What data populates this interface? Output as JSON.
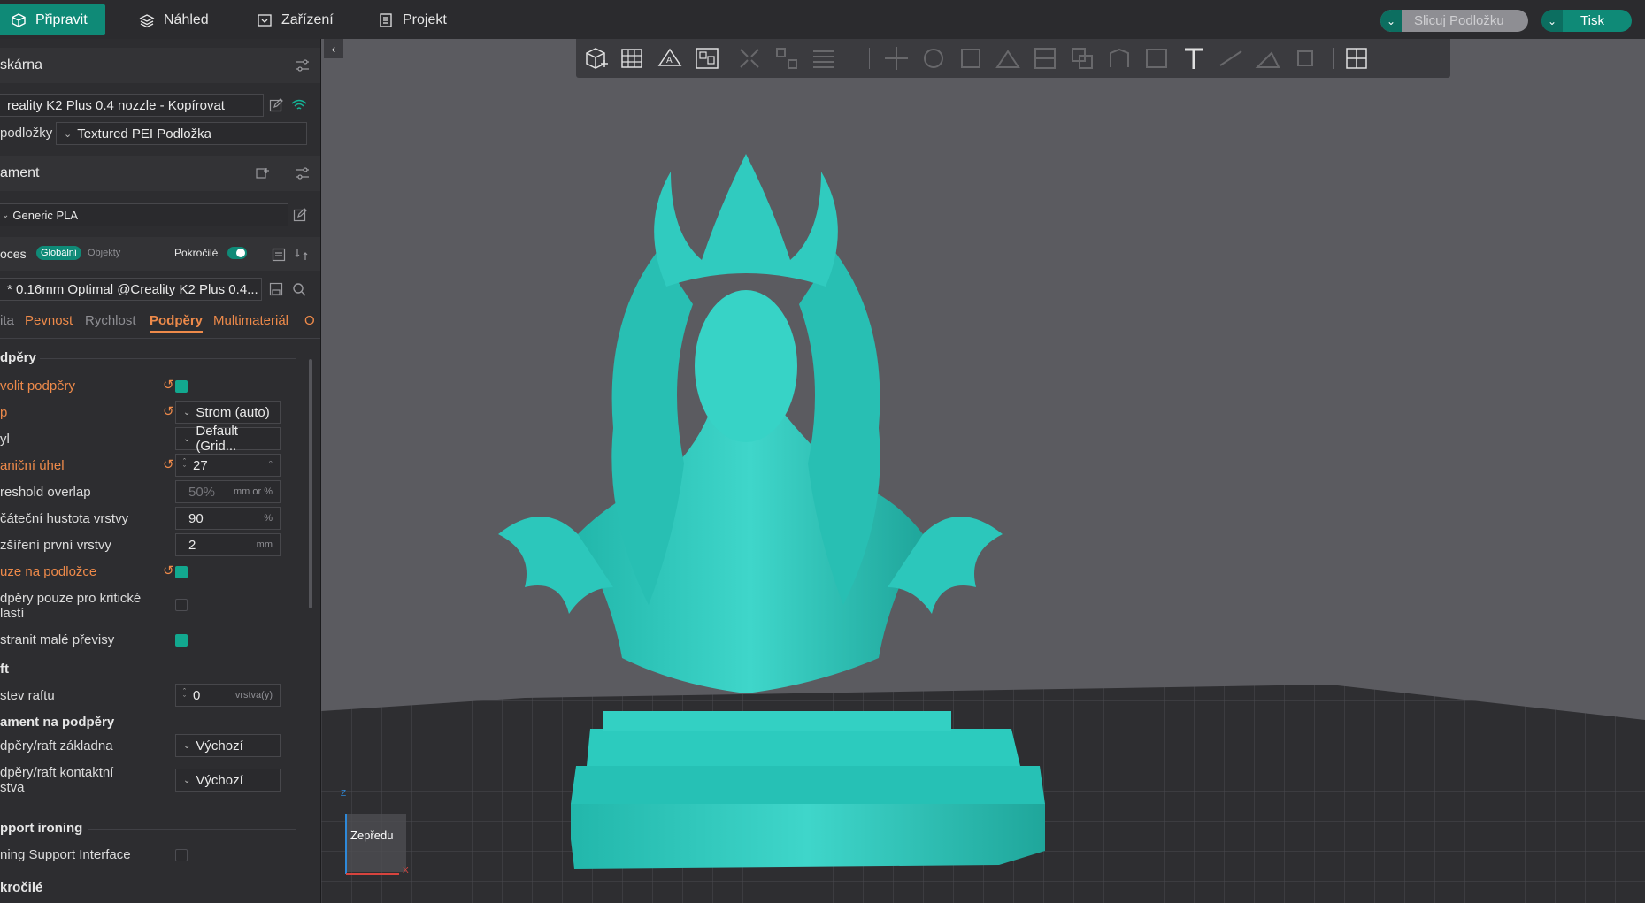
{
  "top_tabs": [
    {
      "label": "Připravit",
      "active": true
    },
    {
      "label": "Náhled"
    },
    {
      "label": "Zařízení"
    },
    {
      "label": "Projekt"
    }
  ],
  "top_actions": {
    "slice_label": "Slicuj Podložku",
    "print_label": "Tisk"
  },
  "printer": {
    "section_title": "skárna",
    "printer_name": "reality K2 Plus 0.4 nozzle - Kopírovat",
    "bed_label": "podložky",
    "bed_value": "Textured PEI Podložka"
  },
  "filament": {
    "section_title": "ament",
    "value": "Generic PLA"
  },
  "process": {
    "section_title": "oces",
    "toggle_global": "Globální",
    "toggle_objects": "Objekty",
    "advanced_label": "Pokročilé",
    "profile": "* 0.16mm Optimal @Creality K2 Plus 0.4..."
  },
  "category_tabs": [
    "ita",
    "Pevnost",
    "Rychlost",
    "Podpěry",
    "Multimateriál",
    "O"
  ],
  "groups": {
    "supports": "dpěry",
    "raft": "ft",
    "filament_supports": "ament na podpěry",
    "support_ironing": "pport ironing",
    "advanced": "kročilé"
  },
  "settings": {
    "enable_supports": "volit podpěry",
    "type_label": "p",
    "type_value": "Strom (auto)",
    "style_label": "yl",
    "style_value": "Default (Grid...",
    "angle_label": "aniční úhel",
    "angle_value": "27",
    "threshold_label": "reshold overlap",
    "threshold_value": "50%",
    "threshold_unit": "mm or %",
    "initial_density_label": "čáteční hustota vrstvy",
    "initial_density_value": "90",
    "initial_density_unit": "%",
    "first_layer_exp_label": "zšíření první vrstvy",
    "first_layer_exp_value": "2",
    "first_layer_exp_unit": "mm",
    "on_bed_only_label": "uze na podložce",
    "critical_only_label_1": "dpěry pouze pro kritické",
    "critical_only_label_2": "lastí",
    "remove_small_label": "stranit malé převisy",
    "raft_layers_label": "stev raftu",
    "raft_layers_value": "0",
    "raft_layers_unit": "vrstva(y)",
    "base_label": "dpěry/raft základna",
    "base_value": "Výchozí",
    "interface_label_1": "dpěry/raft kontaktní",
    "interface_label_2": "stva",
    "interface_value": "Výchozí",
    "ironing_label": "ning Support Interface"
  },
  "viewport": {
    "view_label": "Zepředu",
    "axis_z": "Z",
    "axis_x": "X"
  },
  "colors": {
    "accent": "#0f8a77",
    "model": "#2ec9bd",
    "warning": "#ee8a4a"
  }
}
